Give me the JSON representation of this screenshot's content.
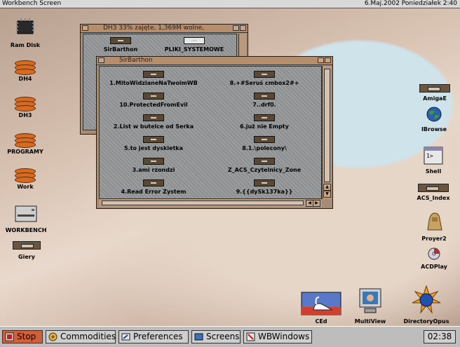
{
  "screen": {
    "title": "Workbench Screen",
    "status": "6.Maj.2002 Poniedziałek 2:40"
  },
  "desktop_icons": {
    "ram": "Ram Disk",
    "dh4": "DH4",
    "dh3": "DH3",
    "programy": "PROGRAMY",
    "work": "Work",
    "workbench": "WORKBENCH",
    "giery": "Giery",
    "amigae": "AmigaE",
    "ibrowse": "IBrowse",
    "shell": "Shell",
    "acs_index": "ACS_Index",
    "proyer2": "Proyer2",
    "acdplay": "ACDPlay",
    "ced": "CEd",
    "multiview": "MultiView",
    "directoryopus": "DirectoryOpus"
  },
  "window_dh3": {
    "title": "DH3  33% zajęte, 1,369M wolne,",
    "items": [
      "SirBarthon",
      "PLIKI_SYSTEMOWE"
    ]
  },
  "window_sir": {
    "title": "SirBarthon",
    "left_items": [
      "1.MitoWidzianeNaTwoimWB",
      "10.ProtectedFromEvil",
      "2.List w butelce od Serka",
      "5.to jest dyskietka",
      "3.ami rzondzi",
      "4.Read Error Zystem"
    ],
    "right_items": [
      "8.+#Seruś cmbox2#+",
      "7..drf0.",
      "6.już nie Empty",
      "8.1.\\polecony\\",
      "Z_ACS_Czytelnicy_Zone",
      "9.{{dySk137ka}}"
    ]
  },
  "taskbar": {
    "stop": "Stop",
    "commodities": "Commodities",
    "preferences": "Preferences",
    "screens": "Screens",
    "wbwindows": "WBWindows",
    "clock": "02:38"
  }
}
